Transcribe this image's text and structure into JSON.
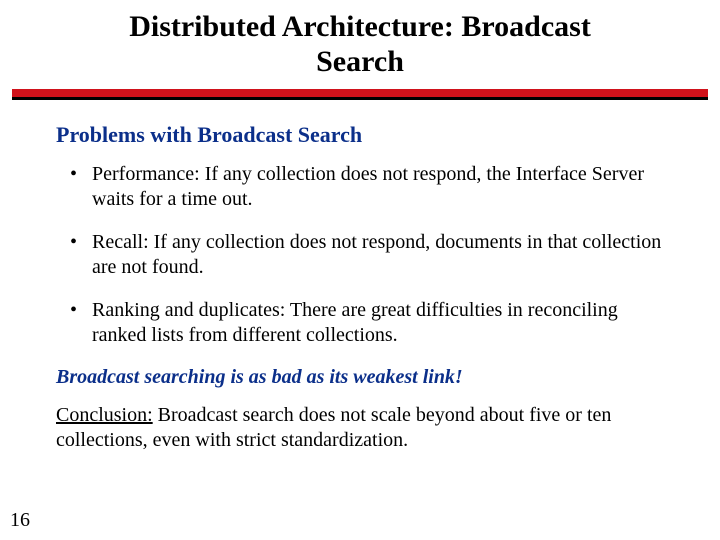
{
  "title_line1": "Distributed Architecture: Broadcast",
  "title_line2": "Search",
  "subhead": "Problems with Broadcast Search",
  "bullets": [
    "Performance: If any collection does not respond, the Interface Server waits for a time out.",
    "Recall:  If any collection does not respond, documents in that collection are not found.",
    "Ranking and duplicates:  There are great difficulties in reconciling ranked lists from different collections."
  ],
  "callout": "Broadcast searching is as bad as its weakest link!",
  "conclusion_label": "Conclusion:",
  "conclusion_text": "  Broadcast search does not scale beyond about five or ten collections, even with strict standardization.",
  "page_number": "16"
}
